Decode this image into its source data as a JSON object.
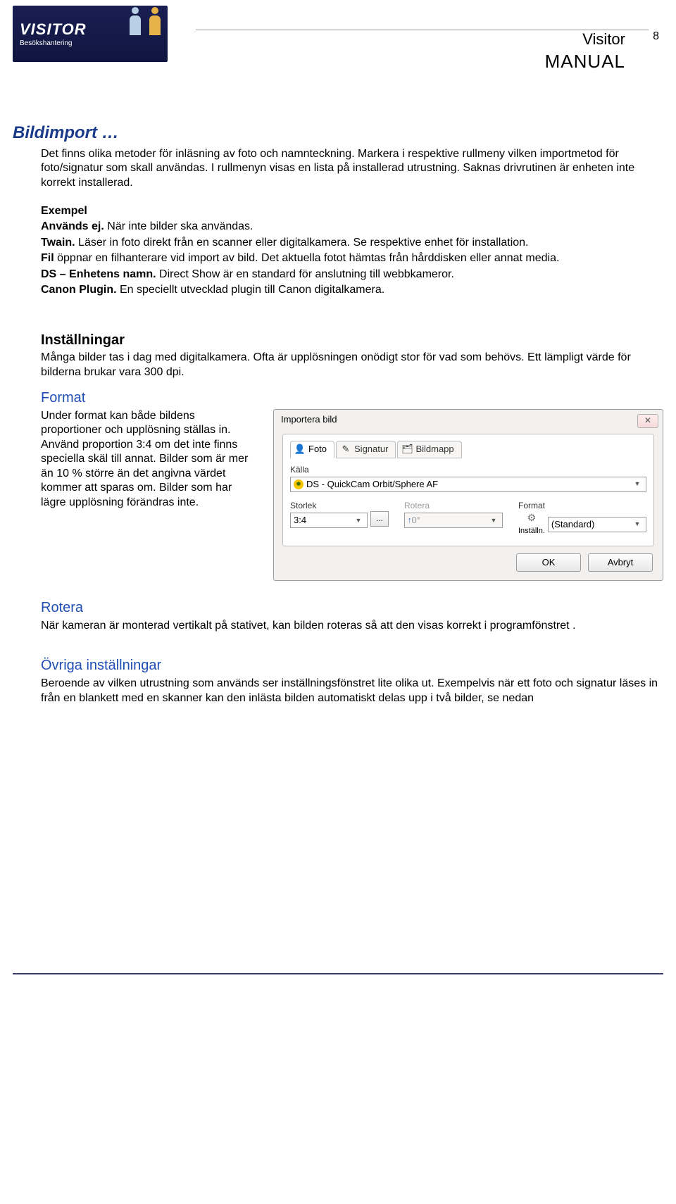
{
  "header": {
    "logo_title": "VISITOR",
    "logo_sub": "Besökshantering",
    "visitor": "Visitor",
    "manual": "MANUAL",
    "page": "8"
  },
  "h_bildimport": "Bildimport …",
  "p_intro1": "Det finns olika metoder för inläsning av foto och namnteckning. Markera i respektive rullmeny vilken importmetod för foto/signatur som skall användas. I rullmenyn visas en lista på installerad utrustning. Saknas drivrutinen är enheten inte korrekt installerad.",
  "lbl_exempel": "Exempel",
  "lbl_anvands_ej": "Används ej.",
  "txt_anvands_ej": " När inte bilder ska användas.",
  "lbl_twain": "Twain.",
  "txt_twain": " Läser in foto direkt från en scanner eller digitalkamera. Se respektive enhet för installation.",
  "lbl_fil": "Fil",
  "txt_fil": " öppnar en filhanterare vid import av bild. Det aktuella fotot hämtas från hårddisken eller annat media.",
  "lbl_ds": "DS – Enhetens namn.",
  "txt_ds": " Direct Show är en standard för anslutning till webbkameror.",
  "lbl_canon": "Canon Plugin.",
  "txt_canon": " En speciellt utvecklad plugin till Canon digitalkamera.",
  "h_installningar": "Inställningar",
  "p_installningar": "Många bilder tas i dag med digitalkamera. Ofta är upplösningen onödigt stor för vad som behövs. Ett lämpligt värde för bilderna brukar vara 300 dpi.",
  "h_format": "Format",
  "p_format": "Under format kan både bildens proportioner och upplösning ställas in.\nAnvänd proportion 3:4 om det inte finns speciella skäl till annat. Bilder som är mer än 10 % större än det angivna värdet kommer att sparas om. Bilder som har lägre upplösning förändras inte.",
  "h_rotera": "Rotera",
  "p_rotera": "När kameran är monterad vertikalt på stativet, kan bilden roteras så att den visas korrekt i programfönstret .",
  "h_ovriga": "Övriga inställningar",
  "p_ovriga": "Beroende av vilken utrustning som används ser inställningsfönstret lite olika ut. Exempelvis när ett foto och signatur läses in från en blankett med en skanner kan den inlästa bilden automatiskt delas upp i två bilder, se nedan",
  "dialog": {
    "title": "Importera bild",
    "close": "✕",
    "tabs": {
      "foto": "Foto",
      "signatur": "Signatur",
      "bildmapp": "Bildmapp"
    },
    "kalla_label": "Källa",
    "kalla_value": "DS - QuickCam Orbit/Sphere AF",
    "storlek_label": "Storlek",
    "storlek_value": "3:4",
    "dots": "...",
    "rotera_label": "Rotera",
    "rotera_value": "0°",
    "installn_label": "Inställn.",
    "format_label": "Format",
    "format_value": "(Standard)",
    "ok": "OK",
    "avbryt": "Avbryt"
  }
}
